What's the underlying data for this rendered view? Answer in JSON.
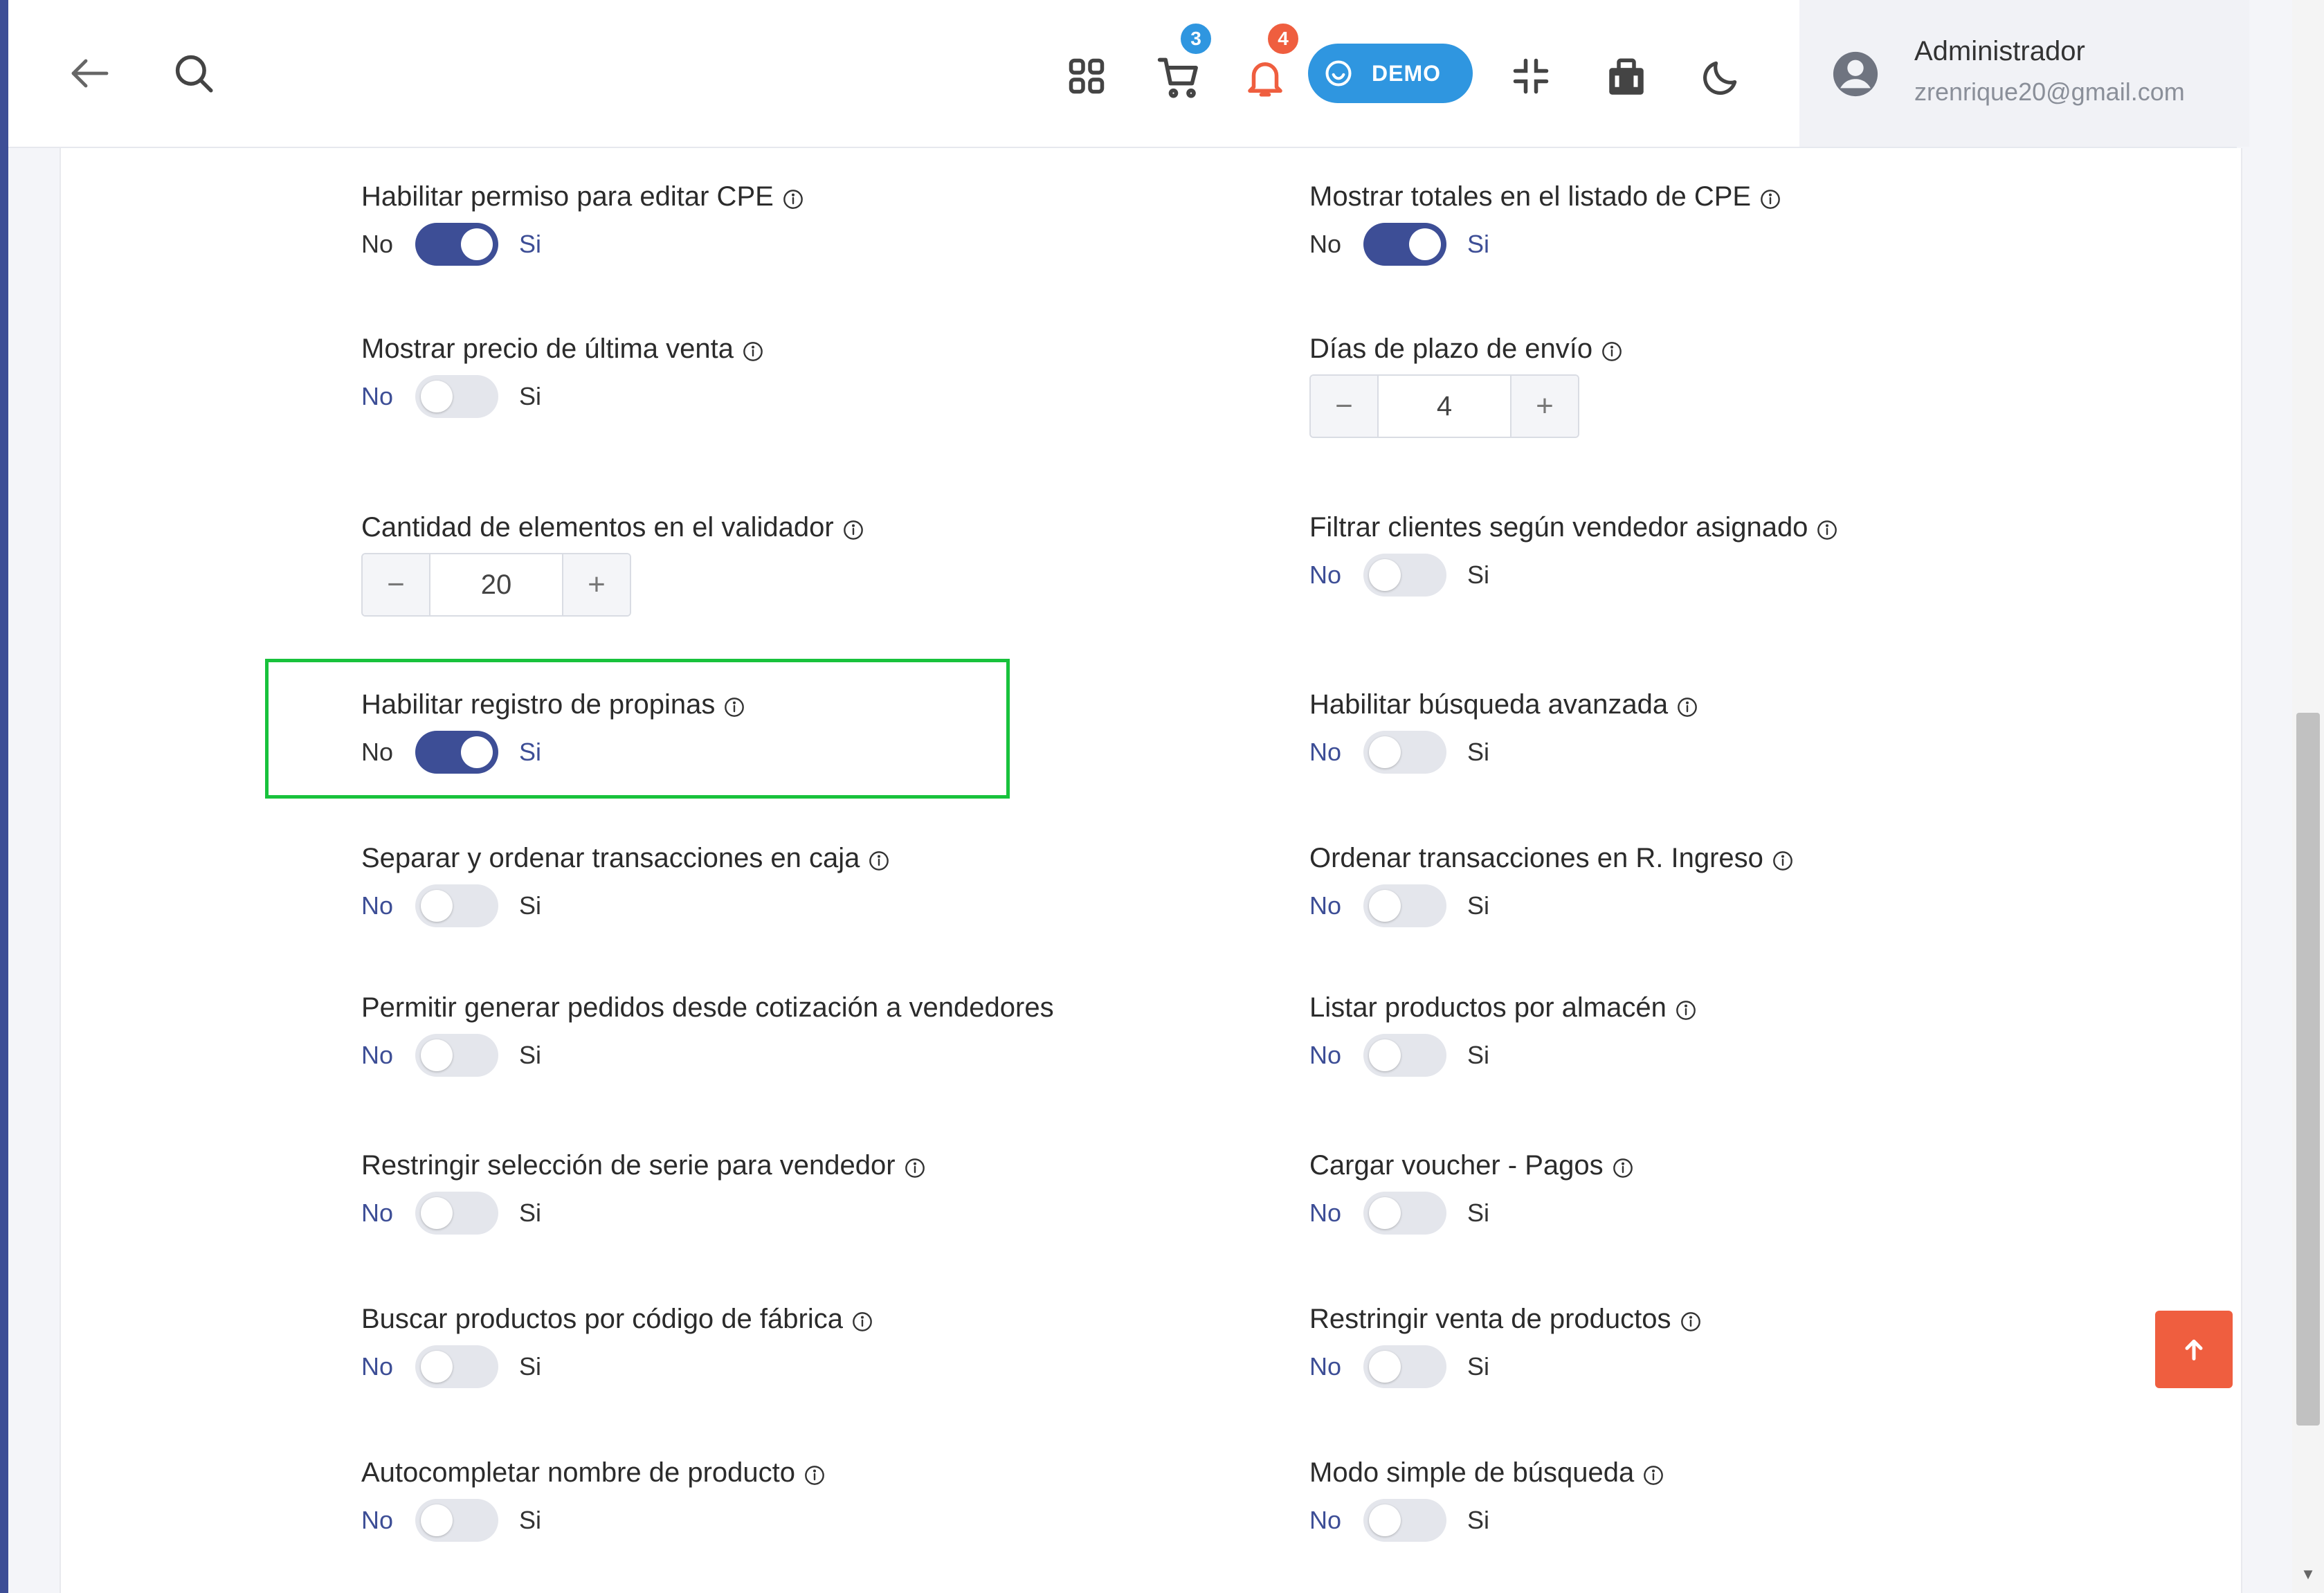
{
  "header": {
    "back_icon": "arrow-left-icon",
    "search_icon": "search-icon",
    "apps_icon": "grid-icon",
    "cart_badge": "3",
    "notifications_badge": "4",
    "demo_label": "DEMO",
    "fullscreen_icon": "compress-icon",
    "store_icon": "store-icon",
    "theme_icon": "moon-icon",
    "user_name": "Administrador",
    "user_email": "zrenrique20@gmail.com",
    "colors": {
      "accent": "#3d4e96",
      "demo": "#2f96e0",
      "badge_blue": "#2f96e0",
      "badge_red": "#ef5e3f"
    }
  },
  "toggle_labels": {
    "no": "No",
    "si": "Si"
  },
  "settings": {
    "left": [
      {
        "label": "Habilitar permiso para editar CPE",
        "type": "toggle",
        "on": true
      },
      {
        "label": "Mostrar precio de última venta",
        "type": "toggle",
        "on": false
      },
      {
        "label": "Cantidad de elementos en el validador",
        "type": "stepper",
        "value": "20"
      },
      {
        "label": "Habilitar registro de propinas",
        "type": "toggle",
        "on": true
      },
      {
        "label": "Separar y ordenar transacciones en caja",
        "type": "toggle",
        "on": false
      },
      {
        "label": "Permitir generar pedidos desde cotización a vendedores",
        "type": "toggle",
        "on": false
      },
      {
        "label": "Restringir selección de serie para vendedor",
        "type": "toggle",
        "on": false
      },
      {
        "label": "Buscar productos por código de fábrica",
        "type": "toggle",
        "on": false
      },
      {
        "label": "Autocompletar nombre de producto",
        "type": "toggle",
        "on": false
      }
    ],
    "right": [
      {
        "label": "Mostrar totales en el listado de CPE",
        "type": "toggle",
        "on": true
      },
      {
        "label": "Días de plazo de envío",
        "type": "stepper",
        "value": "4"
      },
      {
        "label": "Filtrar clientes según vendedor asignado",
        "type": "toggle",
        "on": false
      },
      {
        "label": "Habilitar búsqueda avanzada",
        "type": "toggle",
        "on": false
      },
      {
        "label": "Ordenar transacciones en R. Ingreso",
        "type": "toggle",
        "on": false
      },
      {
        "label": "Listar productos por almacén",
        "type": "toggle",
        "on": false
      },
      {
        "label": "Cargar voucher - Pagos",
        "type": "toggle",
        "on": false
      },
      {
        "label": "Restringir venta de productos",
        "type": "toggle",
        "on": false
      },
      {
        "label": "Modo simple de búsqueda",
        "type": "toggle",
        "on": false
      }
    ]
  },
  "stepper_controls": {
    "minus": "−",
    "plus": "+"
  },
  "scroll_top_icon": "arrow-up-icon"
}
